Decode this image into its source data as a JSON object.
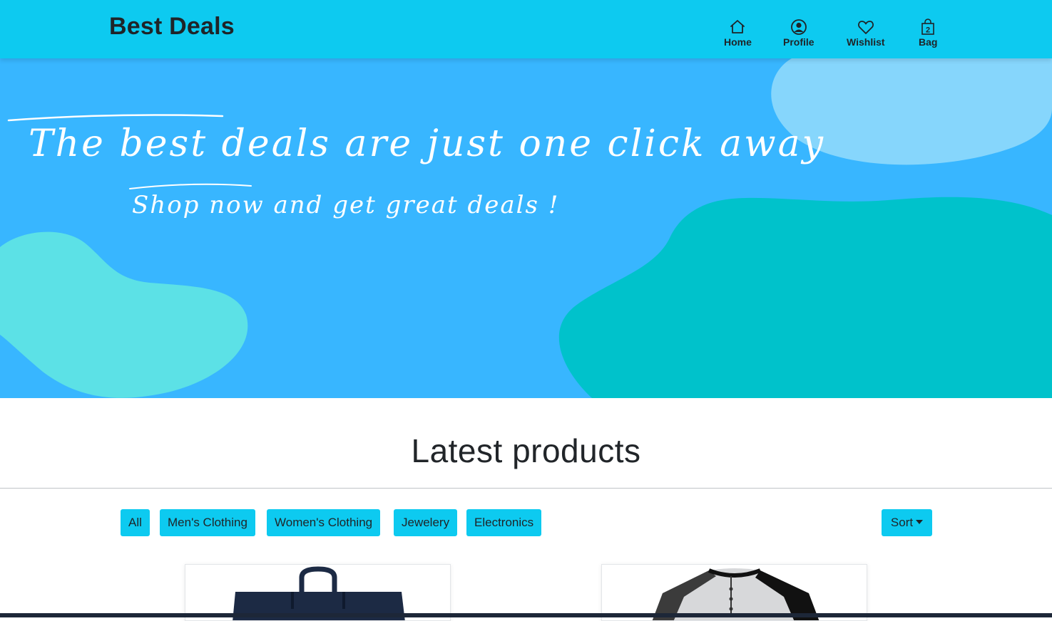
{
  "header": {
    "brand": "Best Deals",
    "nav": [
      {
        "label": "Home",
        "icon": "home-icon"
      },
      {
        "label": "Profile",
        "icon": "profile-icon"
      },
      {
        "label": "Wishlist",
        "icon": "heart-icon"
      },
      {
        "label": "Bag",
        "icon": "bag-icon",
        "badge": "2"
      }
    ]
  },
  "hero": {
    "line1": "The best deals are just one click away",
    "line2": "Shop now and get great deals !"
  },
  "products_section": {
    "title": "Latest products",
    "filters": [
      "All",
      "Men's Clothing",
      "Women's Clothing",
      "Jewelery",
      "Electronics"
    ],
    "sort_label": "Sort"
  },
  "products": [
    {
      "image": "backpack-image"
    },
    {
      "image": "raglan-shirt-image"
    }
  ],
  "colors": {
    "navbar": "#0dcaf0",
    "hero_bg": "#38b6ff",
    "blob_light": "#86d6fc",
    "blob_teal": "#00c2cb",
    "blob_aqua": "#5ce1e6",
    "button": "#0dcaf0"
  }
}
